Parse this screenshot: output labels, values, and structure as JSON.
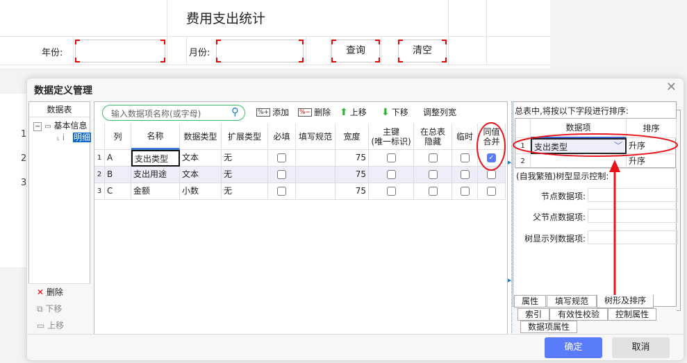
{
  "form": {
    "title": "费用支出统计",
    "year_label": "年份:",
    "month_label": "月份:",
    "query_button": "查询",
    "clear_button": "清空",
    "year_value": "",
    "month_value": ""
  },
  "background_rows": [
    "1",
    "2",
    "3"
  ],
  "dialog": {
    "title": "数据定义管理",
    "left": {
      "header": "数据表",
      "tree": {
        "root": "基本信息",
        "child": "明细"
      },
      "delete": "删除",
      "move_down": "下移",
      "move_up": "上移"
    },
    "toolbar": {
      "search_placeholder": "输入数据项名称(或字母)",
      "add": "添加",
      "delete": "删除",
      "move_up": "上移",
      "move_down": "下移",
      "adjust_width": "调整列宽"
    },
    "grid": {
      "headers": [
        "列",
        "名称",
        "数据类型",
        "扩展类型",
        "必填",
        "填写规范",
        "宽度",
        "主键\n(唯一标识)",
        "在总表\n隐藏",
        "临时",
        "同值\n合并"
      ],
      "rows": [
        {
          "n": "1",
          "col": "A",
          "name": "支出类型",
          "type": "文本",
          "ext": "无",
          "required": false,
          "rule": "",
          "width": "75",
          "pk": false,
          "hide": false,
          "temp": false,
          "merge": true
        },
        {
          "n": "2",
          "col": "B",
          "name": "支出用途",
          "type": "文本",
          "ext": "无",
          "required": false,
          "rule": "",
          "width": "75",
          "pk": false,
          "hide": false,
          "temp": false,
          "merge": false
        },
        {
          "n": "3",
          "col": "C",
          "name": "金额",
          "type": "小数",
          "ext": "无",
          "required": false,
          "rule": "",
          "width": "75",
          "pk": false,
          "hide": false,
          "temp": false,
          "merge": false
        }
      ]
    },
    "right": {
      "sort_label": "总表中,将按以下字段进行排序:",
      "sort_headers": [
        "数据项",
        "排序"
      ],
      "sort_rows": [
        {
          "n": "1",
          "item": "支出类型",
          "order": "升序"
        },
        {
          "n": "2",
          "item": "",
          "order": "升序"
        }
      ],
      "tree_label": "(自我繁殖)树型显示控制:",
      "node_label": "节点数据项:",
      "parent_label": "父节点数据项:",
      "display_label": "树显示列数据项:",
      "node_value": "",
      "parent_value": "",
      "display_value": ""
    },
    "tabs": {
      "row1": [
        "属性",
        "填写规范",
        "树形及排序"
      ],
      "row2": [
        "索引",
        "有效性校验",
        "控制属性"
      ],
      "row3": [
        "数据项属性"
      ],
      "active": "树形及排序"
    },
    "ok": "确定",
    "cancel": "取消"
  },
  "colors": {
    "accent": "#5b7cfa",
    "annotation": "#e8141c",
    "selection": "#0a64d2",
    "row_alt": "#eeeefa"
  }
}
